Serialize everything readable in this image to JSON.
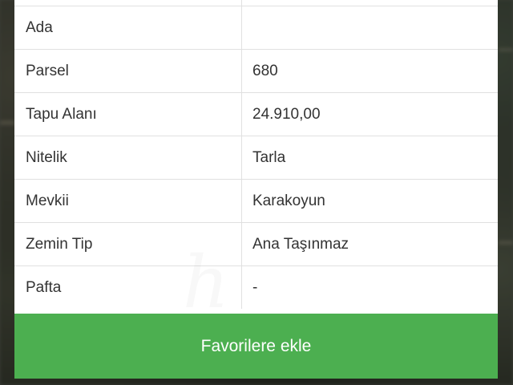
{
  "property_table": {
    "rows": [
      {
        "label": "Ada",
        "value": ""
      },
      {
        "label": "Parsel",
        "value": "680"
      },
      {
        "label": "Tapu Alanı",
        "value": "24.910,00"
      },
      {
        "label": "Nitelik",
        "value": "Tarla"
      },
      {
        "label": "Mevkii",
        "value": "Karakoyun"
      },
      {
        "label": "Zemin Tip",
        "value": "Ana Taşınmaz"
      },
      {
        "label": "Pafta",
        "value": "-"
      }
    ]
  },
  "actions": {
    "favorite_label": "Favorilere ekle"
  },
  "colors": {
    "button_green": "#4caf50",
    "panel_bg": "#ffffff",
    "text": "#333333",
    "divider": "#e0e0e0"
  }
}
